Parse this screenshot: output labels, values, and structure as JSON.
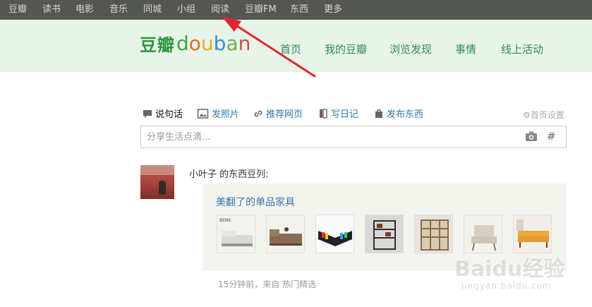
{
  "topnav": [
    "豆瓣",
    "读书",
    "电影",
    "音乐",
    "同城",
    "小组",
    "阅读",
    "豆瓣FM",
    "东西",
    "更多"
  ],
  "logo": {
    "cn": "豆瓣",
    "en": [
      "d",
      "o",
      "u",
      "b",
      "a",
      "n"
    ],
    "en_colors": [
      "#3aa346",
      "#e26a2c",
      "#e4b11c",
      "#3a8ed1",
      "#6db34a",
      "#c8543b"
    ]
  },
  "mainnav": [
    "首页",
    "我的豆瓣",
    "浏览发现",
    "事情",
    "线上活动"
  ],
  "publish": {
    "tools": [
      "说句话",
      "发照片",
      "推荐网页",
      "写日记",
      "发布东西"
    ],
    "settings": "首页设置",
    "placeholder": "分享生活点滴..."
  },
  "feed": {
    "user": "小叶子",
    "action": " 的东西豆列:",
    "card_title": "美翻了的单品家具",
    "thumbs": [
      "sofa-bens",
      "sofa-brown",
      "bookshelf-colorful",
      "rack-wood",
      "shelf-cubes",
      "armchair",
      "sofa-orange"
    ],
    "time": "15分钟前，来自 ",
    "source": "热门精选"
  },
  "watermark": {
    "main": "Baidu经验",
    "sub": "jingyan.baidu.com"
  },
  "colors": {
    "topbar": "#545652",
    "header": "#e9f4e9",
    "link": "#3377aa",
    "arrow": "#e3242b"
  }
}
